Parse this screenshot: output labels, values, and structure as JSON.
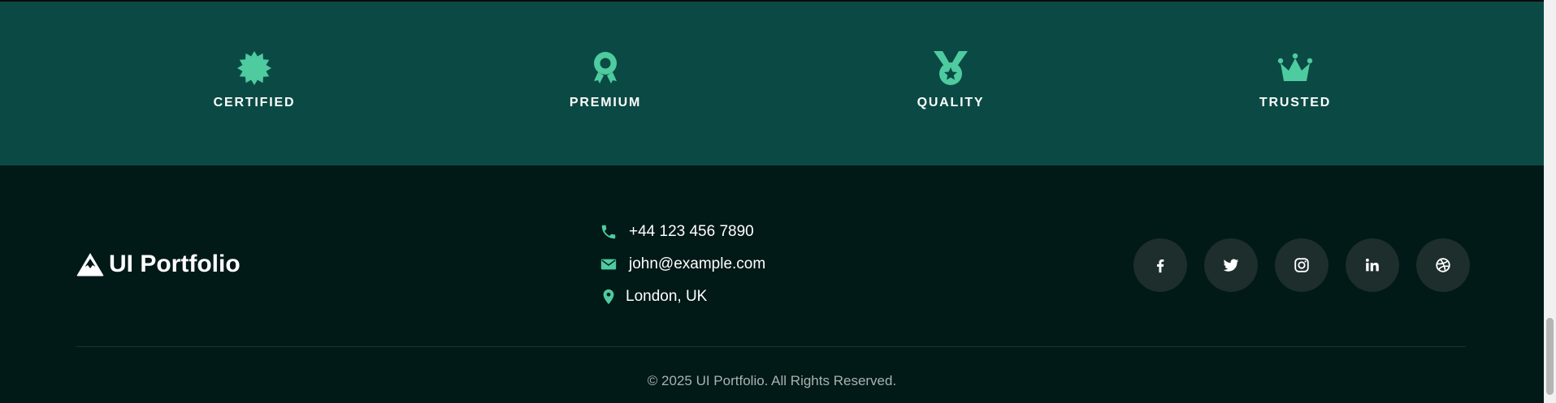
{
  "badges": [
    {
      "label": "CERTIFIED",
      "icon": "certificate-icon"
    },
    {
      "label": "PREMIUM",
      "icon": "award-icon"
    },
    {
      "label": "QUALITY",
      "icon": "medal-icon"
    },
    {
      "label": "TRUSTED",
      "icon": "crown-icon"
    }
  ],
  "footer": {
    "brand": "UI Portfolio",
    "contact": {
      "phone": "+44 123 456 7890",
      "email": "john@example.com",
      "location": "London, UK"
    },
    "socials": [
      "facebook-icon",
      "twitter-icon",
      "instagram-icon",
      "linkedin-icon",
      "dribbble-icon"
    ],
    "copyright": "© 2025 UI Portfolio. All Rights Reserved."
  },
  "colors": {
    "accent": "#4ecb9f",
    "badge_band": "#0b4a44",
    "footer_bg": "#011917",
    "social_bg": "#1d2e2c"
  }
}
